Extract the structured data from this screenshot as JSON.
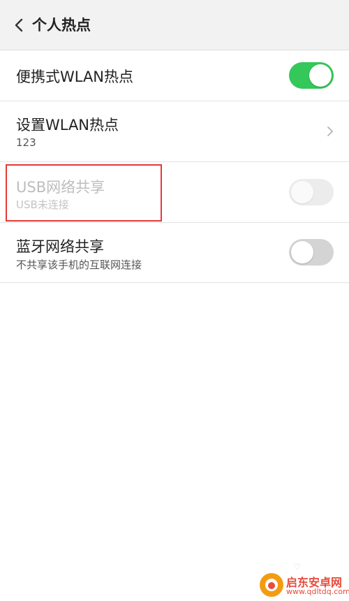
{
  "header": {
    "title": "个人热点",
    "back_icon": "chevron-left-icon"
  },
  "rows": {
    "hotspot": {
      "title": "便携式WLAN热点",
      "toggle_state": "on"
    },
    "wlan_setup": {
      "title": "设置WLAN热点",
      "subtitle": "123",
      "chevron_icon": "chevron-right-icon"
    },
    "usb_share": {
      "title": "USB网络共享",
      "subtitle": "USB未连接",
      "toggle_state": "off-disabled"
    },
    "bt_share": {
      "title": "蓝牙网络共享",
      "subtitle": "不共享该手机的互联网连接",
      "toggle_state": "off"
    }
  },
  "watermark": {
    "name": "启东安卓网",
    "url": "www.qdltdq.com",
    "mark": "♡"
  },
  "colors": {
    "toggle_on": "#34c759",
    "highlight": "#e53935",
    "header_bg": "#f2f2f2"
  }
}
